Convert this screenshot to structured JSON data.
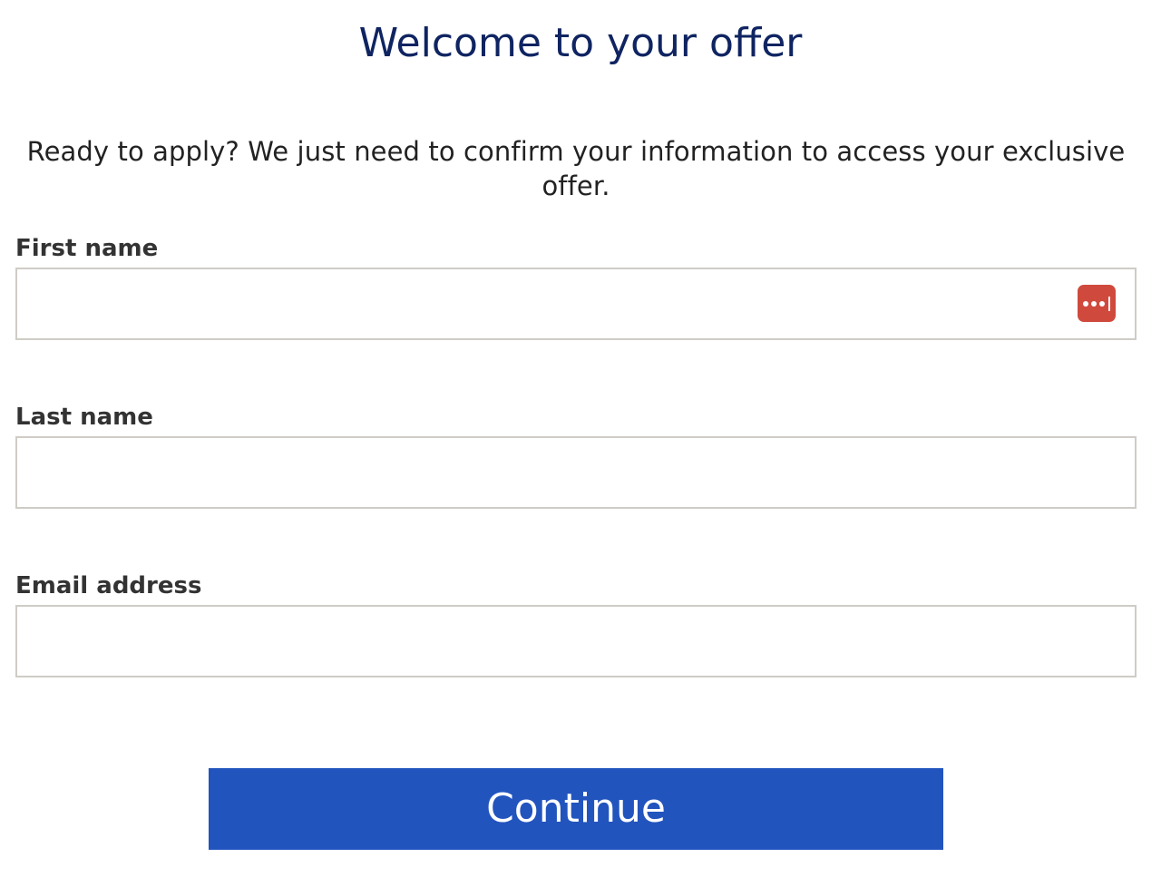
{
  "header": {
    "title": "Welcome to your offer",
    "subtitle": "Ready to apply? We just need to confirm your information to access your exclusive offer."
  },
  "form": {
    "first_name": {
      "label": "First name",
      "value": "",
      "placeholder": "",
      "autofill_icon": "password-manager-icon"
    },
    "last_name": {
      "label": "Last name",
      "value": "",
      "placeholder": ""
    },
    "email": {
      "label": "Email address",
      "value": "",
      "placeholder": ""
    },
    "submit_label": "Continue"
  },
  "colors": {
    "title": "#0f2461",
    "button": "#2254be",
    "input_border": "#cfccc6",
    "autofill_icon": "#cf4a3d"
  }
}
